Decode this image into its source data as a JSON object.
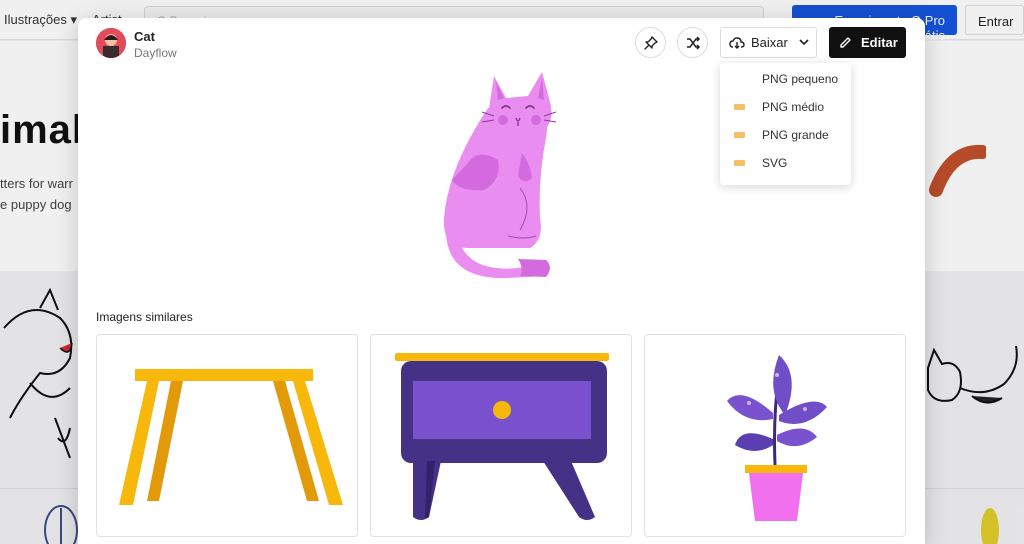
{
  "background": {
    "nav_menu": "Ilustrações",
    "nav_menu2": "Artist",
    "search_placeholder": "Q Pesquisar",
    "cta_label": "Experimente O Pro Grátis",
    "login_label": "Entrar",
    "hero_title": "imal",
    "hero_sub1": "tters for warr",
    "hero_sub2": "e puppy dog"
  },
  "modal": {
    "title": "Cat",
    "author": "Dayflow",
    "download_label": "Baixar",
    "edit_label": "Editar",
    "download_options": [
      {
        "label": "PNG pequeno",
        "tagged": false
      },
      {
        "label": "PNG médio",
        "tagged": true
      },
      {
        "label": "PNG grande",
        "tagged": true
      },
      {
        "label": "SVG",
        "tagged": true
      }
    ],
    "similar_heading": "Imagens similares",
    "similar_items": [
      {
        "name": "table"
      },
      {
        "name": "nightstand"
      },
      {
        "name": "potted-plant"
      }
    ]
  },
  "colors": {
    "cta_blue": "#1655e0",
    "edit_black": "#111111",
    "cat_pink": "#e98df0",
    "cat_dark": "#d36bde",
    "furniture_yellow": "#f7b80b",
    "furniture_purple": "#453185",
    "plant_purple": "#6f4ec8",
    "pot_pink": "#f070ee"
  }
}
